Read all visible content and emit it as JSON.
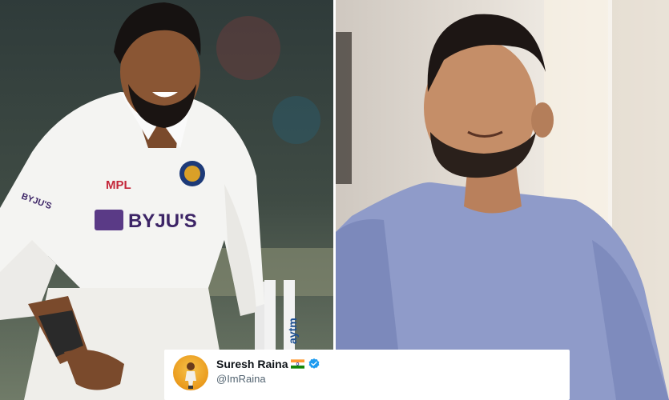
{
  "left_photo": {
    "jersey_brand": "BYJU'S",
    "chest_sponsor": "MPL",
    "sleeve_text": "BYJU'S",
    "stump_text": "aytm"
  },
  "tweet": {
    "display_name": "Suresh Raina",
    "handle": "@ImRaina",
    "flag_icon": "india-flag-icon",
    "verified_icon": "verified-badge-icon",
    "verified_color": "#1d9bf0"
  }
}
